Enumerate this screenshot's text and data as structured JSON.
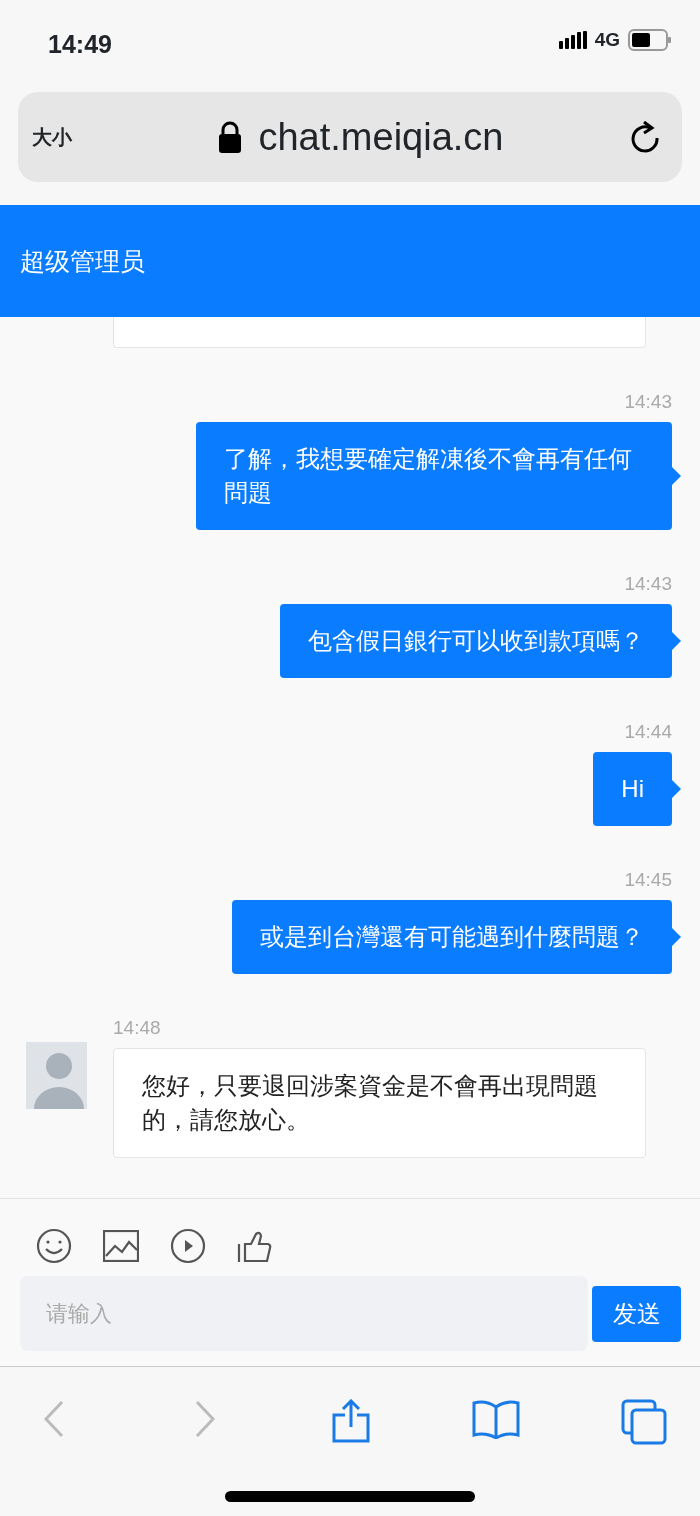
{
  "status_bar": {
    "time": "14:49",
    "network": "4G"
  },
  "address_bar": {
    "text_size": "大小",
    "url": "chat.meiqia.cn"
  },
  "header": {
    "title": "超级管理员"
  },
  "messages": [
    {
      "kind": "partial"
    },
    {
      "kind": "sent",
      "time": "14:43",
      "text": "了解，我想要確定解凍後不會再有任何問題"
    },
    {
      "kind": "sent",
      "time": "14:43",
      "text": "包含假日銀行可以收到款項嗎？"
    },
    {
      "kind": "sent",
      "time": "14:44",
      "text": "Hi"
    },
    {
      "kind": "sent",
      "time": "14:45",
      "text": "或是到台灣還有可能遇到什麼問題？"
    },
    {
      "kind": "received",
      "time": "14:48",
      "text": "您好，只要退回涉案資金是不會再出現問題的，請您放心。"
    }
  ],
  "composer": {
    "placeholder": "请输入",
    "send_button": "发送"
  }
}
